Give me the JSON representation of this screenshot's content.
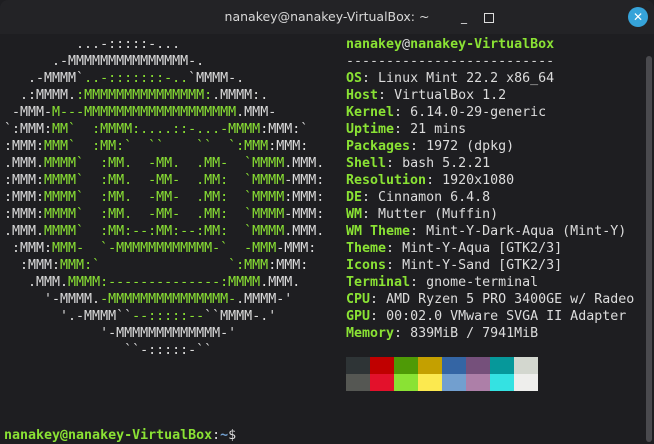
{
  "window": {
    "title": "nanakey@nanakey-VirtualBox: ~",
    "minimize_glyph": "_",
    "close_glyph": "✕"
  },
  "art": [
    [
      [
        "w",
        "         ...-:::::-..."
      ]
    ],
    [
      [
        "w",
        "      .-MMMMMMMMMMMMMMM-."
      ]
    ],
    [
      [
        "w",
        "   .-MMMM`"
      ],
      [
        "g",
        "..-:::::::-.."
      ],
      [
        "w",
        "`MMMM-."
      ]
    ],
    [
      [
        "w",
        "  .:MMMM."
      ],
      [
        "g",
        ":MMMMMMMMMMMMMMM:"
      ],
      [
        "w",
        ".MMMM:."
      ]
    ],
    [
      [
        "w",
        " -MMM-"
      ],
      [
        "g",
        "M---MMMMMMMMMMMMMMMMMMM"
      ],
      [
        "w",
        ".MMM-"
      ]
    ],
    [
      [
        "w",
        "`:MMM:"
      ],
      [
        "g",
        "MM`  :MMMM:....::-...-MMMM"
      ],
      [
        "w",
        ":MMM:`"
      ]
    ],
    [
      [
        "w",
        ":MMM:"
      ],
      [
        "g",
        "MMM`  :MM:`  ``    ``  `:MMM"
      ],
      [
        "w",
        ":MMM:"
      ]
    ],
    [
      [
        "w",
        ".MMM."
      ],
      [
        "g",
        "MMMM`  :MM.  -MM.  .MM-  `MMMM"
      ],
      [
        "w",
        ".MMM."
      ]
    ],
    [
      [
        "w",
        ":MMM:"
      ],
      [
        "g",
        "MMMM`  :MM.  -MM-  .MM:  `MMMM"
      ],
      [
        "w",
        "-MMM:"
      ]
    ],
    [
      [
        "w",
        ":MMM:"
      ],
      [
        "g",
        "MMMM`  :MM.  -MM-  .MM:  `MMMM"
      ],
      [
        "w",
        ":MMM:"
      ]
    ],
    [
      [
        "w",
        ":MMM:"
      ],
      [
        "g",
        "MMMM`  :MM.  -MM-  .MM:  `MMMM"
      ],
      [
        "w",
        "-MMM:"
      ]
    ],
    [
      [
        "w",
        ".MMM."
      ],
      [
        "g",
        "MMMM`  :MM:--:MM:--:MM:  `MMMM"
      ],
      [
        "w",
        ".MMM."
      ]
    ],
    [
      [
        "w",
        " :MMM:"
      ],
      [
        "g",
        "MMM-  `-MMMMMMMMMMMM-`  -MMM"
      ],
      [
        "w",
        "-MMM:"
      ]
    ],
    [
      [
        "w",
        "  :MMM:"
      ],
      [
        "g",
        "MMM:`                `:MMM"
      ],
      [
        "w",
        ":MMM:"
      ]
    ],
    [
      [
        "w",
        "   .MMM."
      ],
      [
        "g",
        "MMMM:--------------:MMMM"
      ],
      [
        "w",
        ".MMM."
      ]
    ],
    [
      [
        "w",
        "     '-MMMM."
      ],
      [
        "g",
        "-MMMMMMMMMMMMMMM-"
      ],
      [
        "w",
        ".MMMM-'"
      ]
    ],
    [
      [
        "w",
        "       '.-MMMM``"
      ],
      [
        "g",
        "--:::::--"
      ],
      [
        "w",
        "``MMMM-.'"
      ]
    ],
    [
      [
        "w",
        "            '-MMMMMMMMMMMMM-'"
      ]
    ],
    [
      [
        "w",
        "               ``-:::::-``"
      ]
    ]
  ],
  "info": {
    "user": "nanakey",
    "at": "@",
    "host": "nanakey-VirtualBox",
    "separator": "--------------------------",
    "fields": [
      {
        "key": "OS",
        "value": "Linux Mint 22.2 x86_64"
      },
      {
        "key": "Host",
        "value": "VirtualBox 1.2"
      },
      {
        "key": "Kernel",
        "value": "6.14.0-29-generic"
      },
      {
        "key": "Uptime",
        "value": "21 mins"
      },
      {
        "key": "Packages",
        "value": "1972 (dpkg)"
      },
      {
        "key": "Shell",
        "value": "bash 5.2.21"
      },
      {
        "key": "Resolution",
        "value": "1920x1080"
      },
      {
        "key": "DE",
        "value": "Cinnamon 6.4.8"
      },
      {
        "key": "WM",
        "value": "Mutter (Muffin)"
      },
      {
        "key": "WM Theme",
        "value": "Mint-Y-Dark-Aqua (Mint-Y)"
      },
      {
        "key": "Theme",
        "value": "Mint-Y-Aqua [GTK2/3]"
      },
      {
        "key": "Icons",
        "value": "Mint-Y-Sand [GTK2/3]"
      },
      {
        "key": "Terminal",
        "value": "gnome-terminal"
      },
      {
        "key": "CPU",
        "value": "AMD Ryzen 5 PRO 3400GE w/ Radeo"
      },
      {
        "key": "GPU",
        "value": "00:02.0 VMware SVGA II Adapter"
      },
      {
        "key": "Memory",
        "value": "839MiB / 7941MiB"
      }
    ]
  },
  "palette": [
    "#2e3436",
    "#c00000",
    "#4e9a06",
    "#c4a000",
    "#3465a4",
    "#75507b",
    "#06989a",
    "#d3d7cf",
    "#555753",
    "#e3112b",
    "#8ae234",
    "#fce94f",
    "#729fcf",
    "#ad7fa8",
    "#34e2e2",
    "#eeeeec"
  ],
  "prompt": {
    "user_host": "nanakey@nanakey-VirtualBox",
    "colon": ":",
    "path": "~",
    "symbol": "$"
  }
}
